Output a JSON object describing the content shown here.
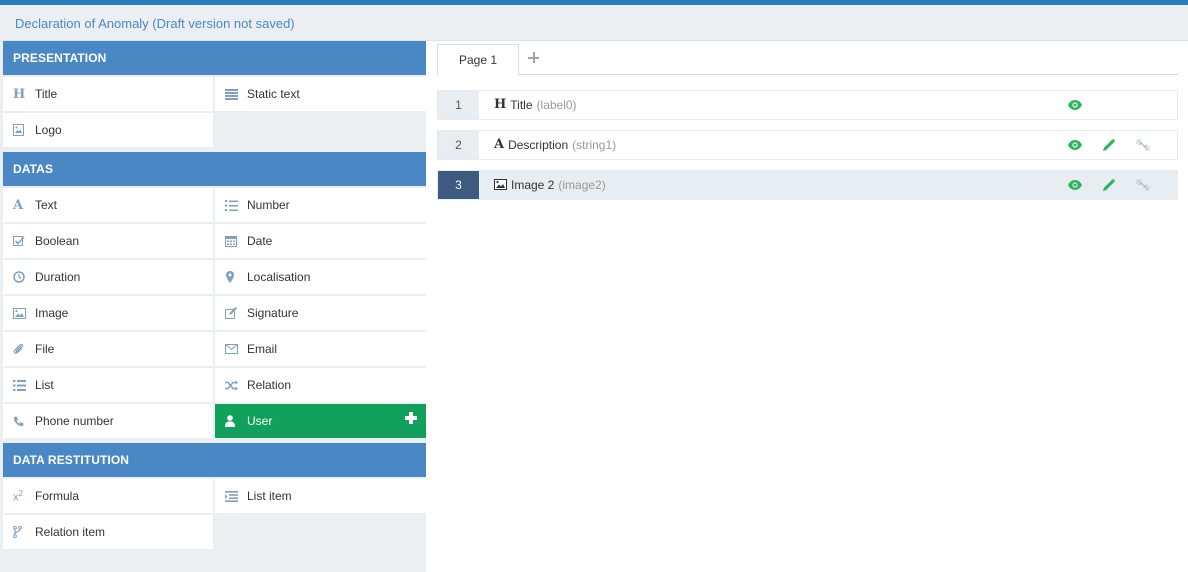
{
  "header": {
    "title": "Declaration of Anomaly (Draft version not saved)"
  },
  "palette": {
    "presentation": {
      "title": "PRESENTATION",
      "items": [
        {
          "label": "Title",
          "icon": "heading-icon"
        },
        {
          "label": "Static text",
          "icon": "align-justify-icon"
        },
        {
          "label": "Logo",
          "icon": "image-file-icon"
        }
      ]
    },
    "datas": {
      "title": "DATAS",
      "items": [
        {
          "label": "Text",
          "icon": "font-icon"
        },
        {
          "label": "Number",
          "icon": "ordered-list-icon"
        },
        {
          "label": "Boolean",
          "icon": "checkbox-icon"
        },
        {
          "label": "Date",
          "icon": "calendar-icon"
        },
        {
          "label": "Duration",
          "icon": "clock-icon"
        },
        {
          "label": "Localisation",
          "icon": "map-marker-icon"
        },
        {
          "label": "Image",
          "icon": "picture-icon"
        },
        {
          "label": "Signature",
          "icon": "edit-icon"
        },
        {
          "label": "File",
          "icon": "paperclip-icon"
        },
        {
          "label": "Email",
          "icon": "envelope-icon"
        },
        {
          "label": "List",
          "icon": "list-icon"
        },
        {
          "label": "Relation",
          "icon": "random-icon"
        },
        {
          "label": "Phone number",
          "icon": "phone-icon"
        },
        {
          "label": "User",
          "icon": "user-icon"
        }
      ]
    },
    "restitution": {
      "title": "DATA RESTITUTION",
      "items": [
        {
          "label": "Formula",
          "icon": "superscript-icon"
        },
        {
          "label": "List item",
          "icon": "indent-list-icon"
        },
        {
          "label": "Relation item",
          "icon": "code-fork-icon"
        }
      ]
    }
  },
  "tabs": [
    {
      "label": "Page 1"
    }
  ],
  "fields": [
    {
      "num": "1",
      "type_icon": "heading-icon",
      "name": "Title",
      "key": "(label0)"
    },
    {
      "num": "2",
      "type_icon": "font-icon",
      "name": "Description",
      "key": "(string1)"
    },
    {
      "num": "3",
      "type_icon": "picture-icon",
      "name": "Image 2",
      "key": "(image2)"
    }
  ],
  "colors": {
    "accent_blue": "#4a87c5",
    "selected_green": "#12a05d",
    "action_green": "#2db55d",
    "active_row_num": "#3d5a80"
  }
}
